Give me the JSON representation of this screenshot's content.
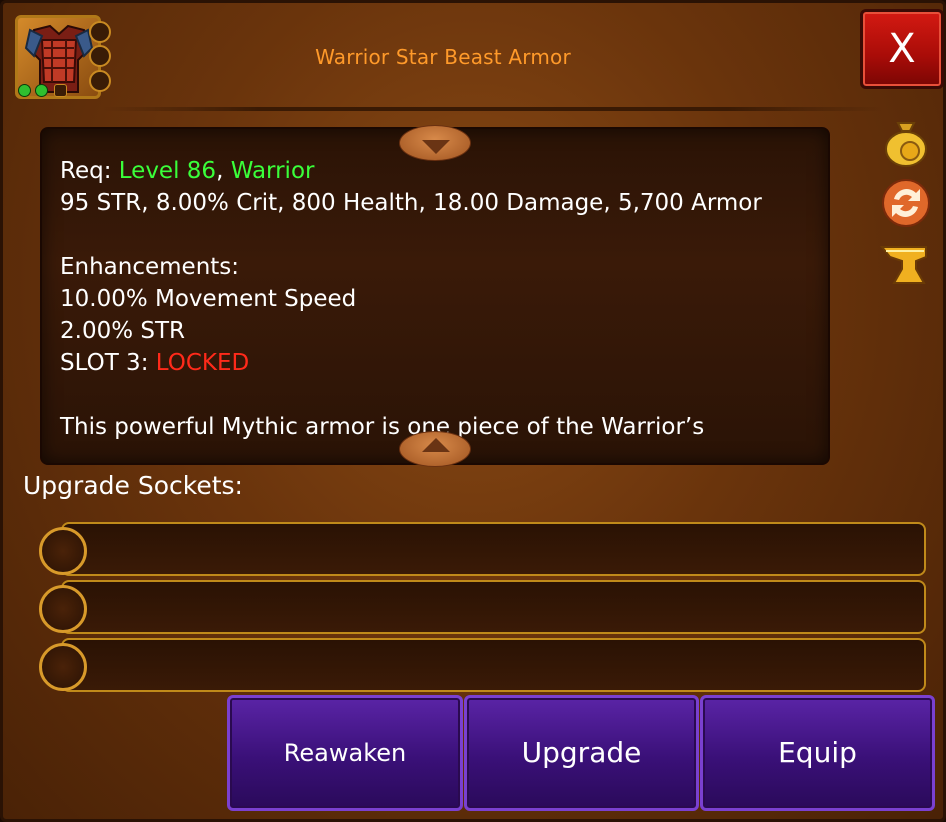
{
  "window": {
    "title": "Warrior Star Beast Armor",
    "close_label": "X"
  },
  "item": {
    "icon": "armor-icon",
    "gem_slots": [
      "filled",
      "filled",
      "empty"
    ]
  },
  "description": {
    "req_label": "Req: ",
    "req_level": "Level 86",
    "req_sep": ", ",
    "req_class": "Warrior",
    "stats": "95 STR, 8.00% Crit, 800 Health, 18.00 Damage, 5,700 Armor",
    "enhancements_label": "Enhancements:",
    "enhancements": [
      "10.00% Movement Speed",
      "2.00% STR"
    ],
    "slot3_label": "SLOT 3: ",
    "slot3_value": "LOCKED",
    "flavor": "This powerful Mythic armor is one piece of the Warrior’s"
  },
  "side_icons": [
    "coin-bag-icon",
    "swap-icon",
    "anvil-icon"
  ],
  "sockets": {
    "label": "Upgrade Sockets:",
    "rows": [
      "",
      "",
      ""
    ]
  },
  "buttons": {
    "reawaken": "Reawaken",
    "upgrade": "Upgrade",
    "equip": "Equip"
  },
  "colors": {
    "title": "#ff9a2a",
    "requirement_ok": "#3aff3a",
    "locked": "#ff2a1a",
    "button_purple": "#3a1078",
    "close_red": "#c8140e"
  }
}
